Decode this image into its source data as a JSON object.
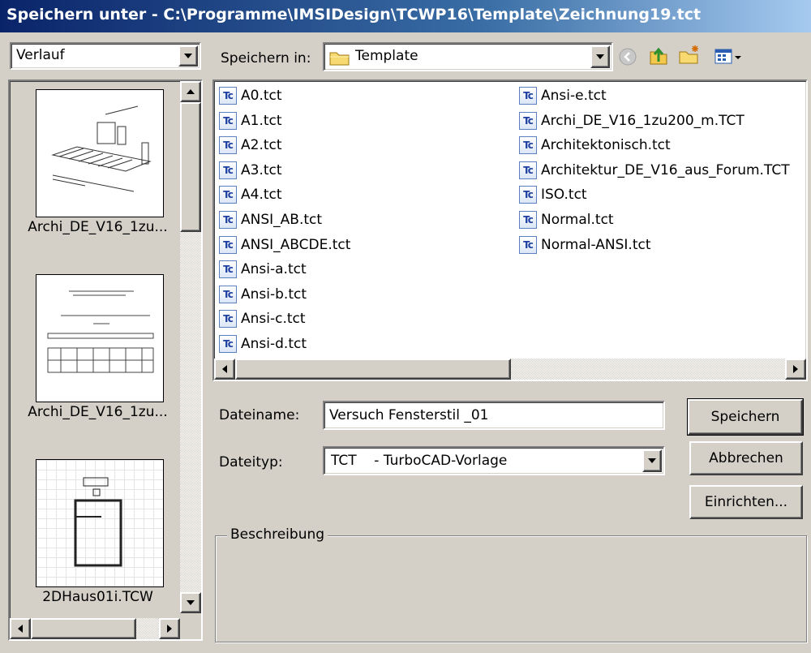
{
  "window": {
    "title": "Speichern unter - C:\\Programme\\IMSIDesign\\TCWP16\\Template\\Zeichnung19.tct"
  },
  "history": {
    "selected": "Verlauf",
    "thumbnails": [
      {
        "label": "Archi_DE_V16_1zu..."
      },
      {
        "label": "Archi_DE_V16_1zu..."
      },
      {
        "label": "2DHaus01i.TCW"
      }
    ]
  },
  "savein": {
    "label": "Speichern in:",
    "folder": "Template"
  },
  "toolbar": {
    "icons": [
      "back-icon",
      "up-folder-icon",
      "new-folder-icon",
      "view-menu-icon"
    ]
  },
  "files": {
    "icon_text": "Tc",
    "col1": [
      "A0.tct",
      "A1.tct",
      "A2.tct",
      "A3.tct",
      "A4.tct",
      "ANSI_AB.tct",
      "ANSI_ABCDE.tct",
      "Ansi-a.tct",
      "Ansi-b.tct",
      "Ansi-c.tct",
      "Ansi-d.tct"
    ],
    "col2": [
      "Ansi-e.tct",
      "Archi_DE_V16_1zu200_m.TCT",
      "Architektonisch.tct",
      "Architektur_DE_V16_aus_Forum.TCT",
      "ISO.tct",
      "Normal.tct",
      "Normal-ANSI.tct"
    ]
  },
  "form": {
    "filename_label": "Dateiname:",
    "filename_value": "Versuch Fensterstil _01",
    "filetype_label": "Dateityp:",
    "filetype_value": "TCT    - TurboCAD-Vorlage"
  },
  "buttons": {
    "save": "Speichern",
    "cancel": "Abbrechen",
    "setup": "Einrichten..."
  },
  "description": {
    "title": "Beschreibung"
  },
  "colors": {
    "titlebar": "#0a246a",
    "face": "#d4d0c8",
    "icon_blue": "#1d3fa0"
  }
}
